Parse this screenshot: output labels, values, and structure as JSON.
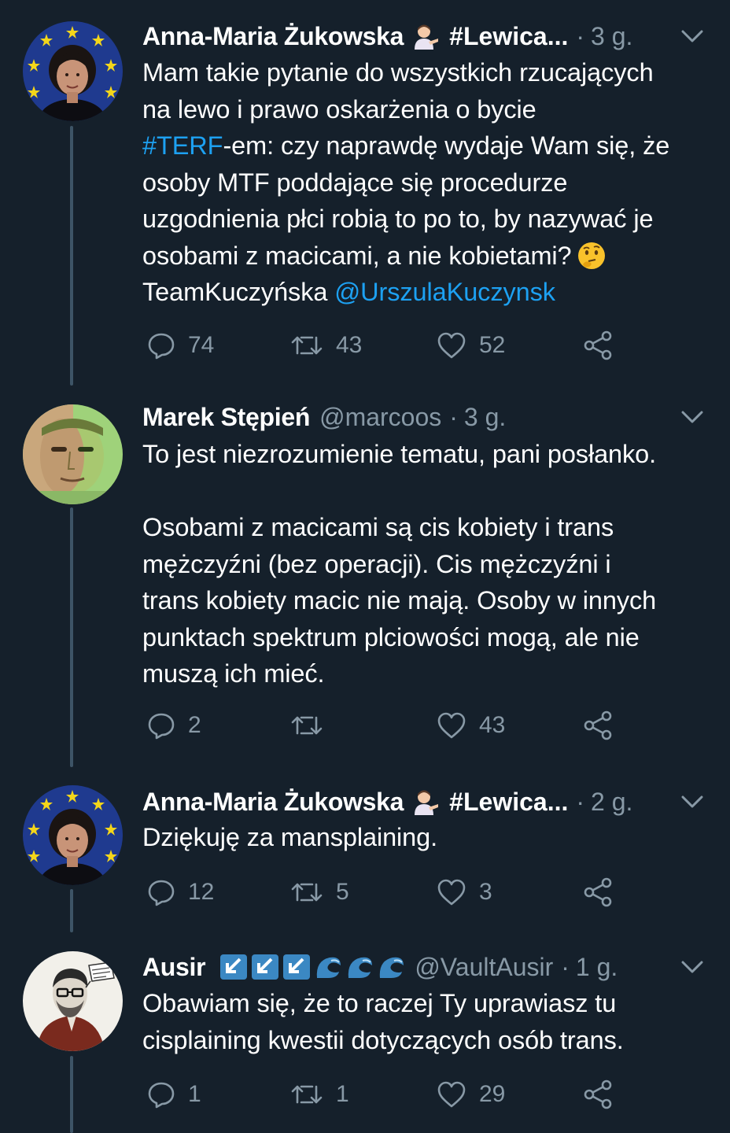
{
  "colors": {
    "background": "#15202b",
    "text": "#ffffff",
    "secondary": "#8899a6",
    "link": "#1da1f2",
    "thread_line": "#3d5466"
  },
  "tweets": [
    {
      "name": "Anna-Maria Żukowska",
      "name_hashtag": "#Lewica...",
      "handle": "",
      "time": "3 g.",
      "lines": [
        "Mam takie pytanie do wszystkich rzucających",
        "na lewo i prawo oskarżenia o bycie",
        "#TERF-em: czy naprawdę wydaje Wam się, że",
        "osoby MTF poddające się procedurze",
        "uzgodnienia płci robią to po to, by nazywać je",
        "osobami z macicami, a nie kobietami?",
        "TeamKuczyńska @UrszulaKuczynsk"
      ],
      "hashtag_link": "#TERF",
      "mention_link": "@UrszulaKuczynsk",
      "team_text": "TeamKuczyńska",
      "replies": "74",
      "retweets": "43",
      "likes": "52"
    },
    {
      "name": "Marek Stępień",
      "handle": "@marcoos",
      "time": "3 g.",
      "lines": [
        "To jest niezrozumienie tematu, pani posłanko.",
        "",
        "Osobami z macicami są cis kobiety i trans",
        "mężczyźni (bez operacji). Cis mężczyźni i",
        "trans kobiety macic nie mają. Osoby w innych",
        "punktach spektrum plciowości mogą, ale nie",
        "muszą ich mieć."
      ],
      "replies": "2",
      "retweets": "",
      "likes": "43"
    },
    {
      "name": "Anna-Maria Żukowska",
      "name_hashtag": "#Lewica...",
      "handle": "",
      "time": "2 g.",
      "lines": [
        "Dziękuję za mansplaining."
      ],
      "replies": "12",
      "retweets": "5",
      "likes": "3"
    },
    {
      "name": "Ausir",
      "handle": "@VaultAusir",
      "time": "1 g.",
      "lines": [
        "Obawiam się, że to raczej Ty uprawiasz tu",
        "cisplaining kwestii dotyczących osób trans."
      ],
      "replies": "1",
      "retweets": "1",
      "likes": "29"
    }
  ],
  "icons": {
    "reply": "reply-icon",
    "retweet": "retweet-icon",
    "like": "heart-icon",
    "share": "share-icon",
    "more": "chevron-down-icon"
  }
}
